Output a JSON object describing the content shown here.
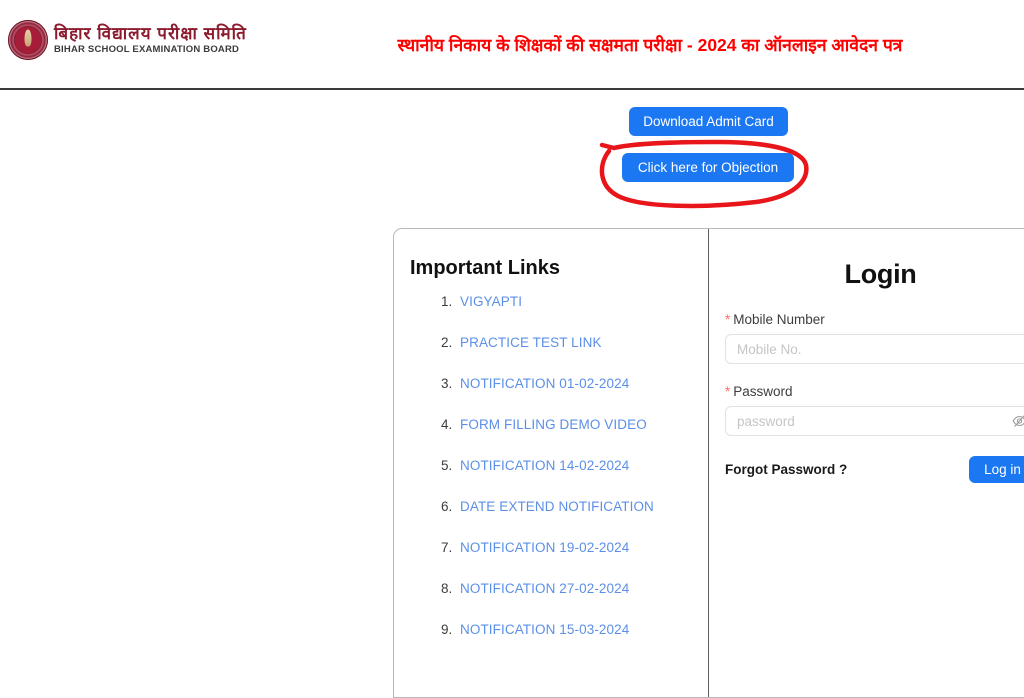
{
  "header": {
    "brand_hindi": "बिहार  विद्यालय  परीक्षा  समिति",
    "brand_english": "BIHAR SCHOOL EXAMINATION BOARD",
    "seal_icon": "bihar-board-seal-icon",
    "page_title": "स्थानीय निकाय के शिक्षकों की सक्षमता परीक्षा - 2024 का ऑनलाइन आवेदन पत्र",
    "title_color": "#fe0000"
  },
  "actions": {
    "download_admit_card_label": "Download Admit Card",
    "objection_label": "Click here for Objection",
    "button_color": "#1b78f2",
    "annotation_color": "#e8161a",
    "annotation_shape": "red-hand-drawn-ellipse"
  },
  "links_panel": {
    "title": "Important Links",
    "items": [
      {
        "label": "VIGYAPTI"
      },
      {
        "label": "PRACTICE TEST LINK"
      },
      {
        "label": "NOTIFICATION 01-02-2024"
      },
      {
        "label": "FORM FILLING DEMO VIDEO"
      },
      {
        "label": "NOTIFICATION 14-02-2024"
      },
      {
        "label": "DATE EXTEND NOTIFICATION"
      },
      {
        "label": "NOTIFICATION 19-02-2024"
      },
      {
        "label": "NOTIFICATION 27-02-2024"
      },
      {
        "label": "NOTIFICATION 15-03-2024"
      }
    ],
    "link_color": "#5b8fe8"
  },
  "login_panel": {
    "title": "Login",
    "required_marker": "*",
    "mobile": {
      "label": "Mobile Number",
      "placeholder": "Mobile No.",
      "value": ""
    },
    "password": {
      "label": "Password",
      "placeholder": "password",
      "value": "",
      "toggle_icon": "eye-slash-icon"
    },
    "forgot_password_label": "Forgot Password ?",
    "login_button_label": "Log in"
  }
}
